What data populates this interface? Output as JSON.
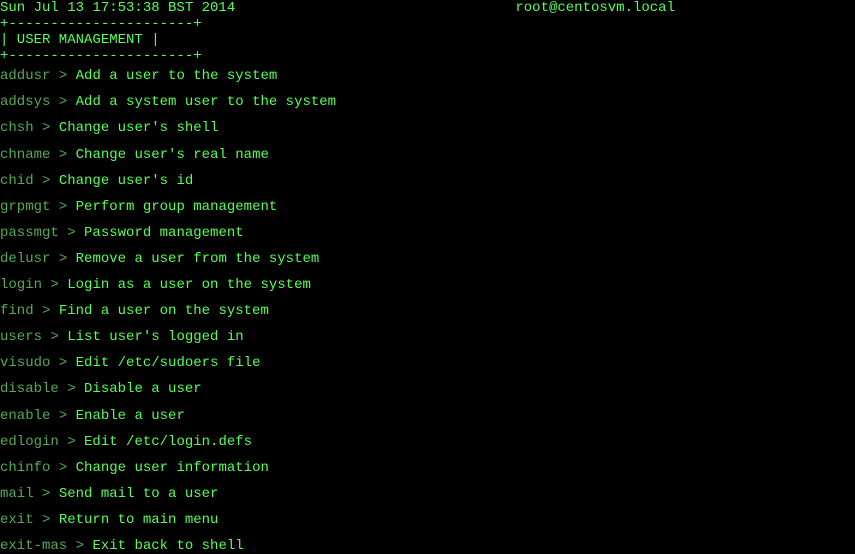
{
  "header": {
    "datetime": "Sun Jul 13 17:53:38 BST 2014",
    "userhost": "root@centosvm.local"
  },
  "box": {
    "top": "+----------------------+",
    "title": "|    USER MANAGEMENT   |",
    "bottom": "+----------------------+"
  },
  "items": [
    {
      "cmd": "addusr",
      "desc": "Add a user to the system"
    },
    {
      "cmd": "addsys",
      "desc": "Add a system user to the system"
    },
    {
      "cmd": "chsh",
      "desc": "Change user's shell"
    },
    {
      "cmd": "chname",
      "desc": "Change user's real name"
    },
    {
      "cmd": "chid",
      "desc": "Change user's id"
    },
    {
      "cmd": "grpmgt",
      "desc": "Perform group management"
    },
    {
      "cmd": "passmgt",
      "desc": "Password management"
    },
    {
      "cmd": "delusr",
      "desc": "Remove a user from the system"
    },
    {
      "cmd": "login",
      "desc": "Login as a user on the system"
    },
    {
      "cmd": "find",
      "desc": "Find a user on the system"
    },
    {
      "cmd": "users",
      "desc": "List user's logged in"
    },
    {
      "cmd": "visudo",
      "desc": "Edit /etc/sudoers file"
    },
    {
      "cmd": "disable",
      "desc": "Disable a user"
    },
    {
      "cmd": "enable",
      "desc": "Enable a user"
    },
    {
      "cmd": "edlogin",
      "desc": "Edit /etc/login.defs"
    },
    {
      "cmd": "chinfo",
      "desc": "Change user information"
    },
    {
      "cmd": "mail",
      "desc": "Send mail to a user"
    },
    {
      "cmd": "exit",
      "desc": "Return to main menu"
    },
    {
      "cmd": "exit-mas",
      "desc": "Exit back to shell"
    }
  ],
  "sep": " > "
}
